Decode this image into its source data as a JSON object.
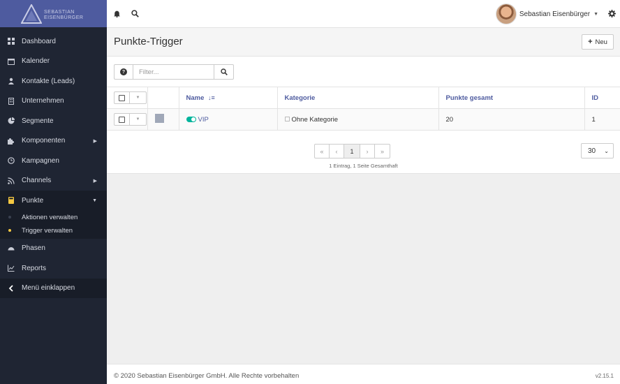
{
  "brand": {
    "line1": "SEBASTIAN",
    "line2": "EISENBÜRGER",
    "color": "#4e5b9f"
  },
  "sidebar": {
    "items": [
      {
        "label": "Dashboard",
        "icon": "dashboard-icon"
      },
      {
        "label": "Kalender",
        "icon": "calendar-icon"
      },
      {
        "label": "Kontakte (Leads)",
        "icon": "user-icon"
      },
      {
        "label": "Unternehmen",
        "icon": "building-icon"
      },
      {
        "label": "Segmente",
        "icon": "pie-chart-icon"
      },
      {
        "label": "Komponenten",
        "icon": "puzzle-icon"
      },
      {
        "label": "Kampagnen",
        "icon": "clock-icon"
      },
      {
        "label": "Channels",
        "icon": "rss-icon"
      },
      {
        "label": "Punkte",
        "icon": "calculator-icon"
      }
    ],
    "sub_items": [
      {
        "label": "Aktionen verwalten"
      },
      {
        "label": "Trigger verwalten"
      }
    ],
    "items_after": [
      {
        "label": "Phasen",
        "icon": "gauge-icon"
      },
      {
        "label": "Reports",
        "icon": "line-chart-icon"
      },
      {
        "label": "Menü einklappen",
        "icon": "chevron-left-icon"
      }
    ]
  },
  "topbar": {
    "user_name": "Sebastian Eisenbürger"
  },
  "page": {
    "title": "Punkte-Trigger",
    "new_button": "Neu"
  },
  "filter": {
    "placeholder": "Filter..."
  },
  "table": {
    "headers": {
      "name": "Name",
      "category": "Kategorie",
      "points": "Punkte gesamt",
      "id": "ID"
    },
    "rows": [
      {
        "name": "VIP",
        "category": "Ohne Kategorie",
        "points": "20",
        "id": "1",
        "color": "#a0a8b8",
        "published": true
      }
    ]
  },
  "pagination": {
    "first": "«",
    "prev": "‹",
    "current": "1",
    "next": "›",
    "last": "»",
    "info": "1 Eintrag, 1 Seite Gesamthaft",
    "per_page": "30"
  },
  "footer": {
    "copyright": "© 2020 Sebastian Eisenbürger GmbH. Alle Rechte vorbehalten",
    "version": "v2.15.1"
  }
}
